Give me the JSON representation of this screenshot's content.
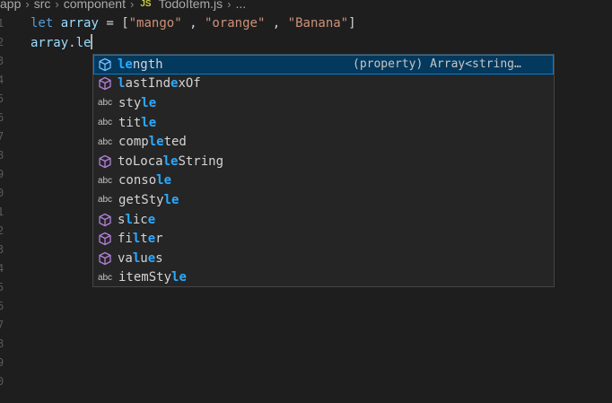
{
  "breadcrumb": {
    "items": [
      "app",
      "src",
      "component"
    ],
    "file_badge": "JS",
    "file_name": "TodoItem.js",
    "ellipsis": "..."
  },
  "editor": {
    "line1": {
      "keyword": "let",
      "identifier": "array",
      "equals": " = ",
      "open_bracket": "[",
      "s1": "\"mango\"",
      "comma1": " , ",
      "s2": "\"orange\"",
      "comma2": " , ",
      "s3": "\"Banana\"",
      "close_bracket": "]"
    },
    "line2": {
      "object": "array",
      "dot": ".",
      "typed": "le"
    }
  },
  "suggestions": [
    {
      "kind": "property",
      "icon": "cube-icon",
      "parts": [
        [
          "le",
          true
        ],
        [
          "ngth",
          false
        ]
      ],
      "detail": "(property) Array<string…"
    },
    {
      "kind": "method",
      "icon": "cube-icon",
      "parts": [
        [
          "l",
          true
        ],
        [
          "astInd",
          false
        ],
        [
          "e",
          true
        ],
        [
          "xOf",
          false
        ]
      ]
    },
    {
      "kind": "text",
      "icon": "abc",
      "parts": [
        [
          "sty",
          false
        ],
        [
          "le",
          true
        ]
      ]
    },
    {
      "kind": "text",
      "icon": "abc",
      "parts": [
        [
          "tit",
          false
        ],
        [
          "le",
          true
        ]
      ]
    },
    {
      "kind": "text",
      "icon": "abc",
      "parts": [
        [
          "comp",
          false
        ],
        [
          "le",
          true
        ],
        [
          "ted",
          false
        ]
      ]
    },
    {
      "kind": "method",
      "icon": "cube-icon",
      "parts": [
        [
          "toLoca",
          false
        ],
        [
          "l",
          true
        ],
        [
          "e",
          true
        ],
        [
          "String",
          false
        ]
      ]
    },
    {
      "kind": "text",
      "icon": "abc",
      "parts": [
        [
          "conso",
          false
        ],
        [
          "le",
          true
        ]
      ]
    },
    {
      "kind": "text",
      "icon": "abc",
      "parts": [
        [
          "getSty",
          false
        ],
        [
          "le",
          true
        ]
      ]
    },
    {
      "kind": "method",
      "icon": "cube-icon",
      "parts": [
        [
          "s",
          false
        ],
        [
          "l",
          true
        ],
        [
          "ic",
          false
        ],
        [
          "e",
          true
        ]
      ]
    },
    {
      "kind": "method",
      "icon": "cube-icon",
      "parts": [
        [
          "fi",
          false
        ],
        [
          "l",
          true
        ],
        [
          "t",
          false
        ],
        [
          "e",
          true
        ],
        [
          "r",
          false
        ]
      ]
    },
    {
      "kind": "method",
      "icon": "cube-icon",
      "parts": [
        [
          "va",
          false
        ],
        [
          "l",
          true
        ],
        [
          "u",
          false
        ],
        [
          "e",
          true
        ],
        [
          "s",
          false
        ]
      ]
    },
    {
      "kind": "text",
      "icon": "abc",
      "parts": [
        [
          "itemSty",
          false
        ],
        [
          "le",
          true
        ]
      ]
    }
  ],
  "colors": {
    "match_highlight": "#2aaaff",
    "method_icon": "#b180d7",
    "property_icon": "#75beff",
    "focus_background": "#04395e"
  }
}
